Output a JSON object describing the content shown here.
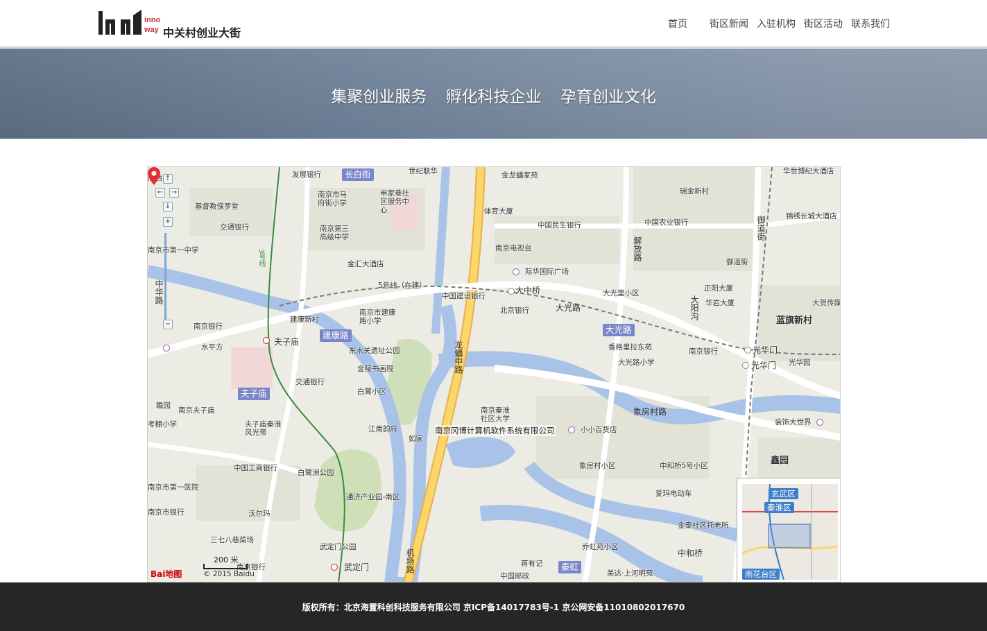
{
  "header": {
    "logo_mark": "in innoway",
    "logo_text": "中关村创业大街",
    "nav": [
      {
        "label": "首页"
      },
      {
        "label": "街区新闻"
      },
      {
        "label": "入驻机构"
      },
      {
        "label": "街区活动"
      },
      {
        "label": "联系我们"
      }
    ]
  },
  "banner": {
    "slogan": [
      "集聚创业服务",
      "孵化科技企业",
      "孕育创业文化"
    ]
  },
  "map": {
    "company_label": "南京冈博计算机软件系统有限公司",
    "scale_label": "200 米",
    "copyright": "© 2015 Baidu",
    "baidu_logo": "Bai地图",
    "zoom_in": "+",
    "zoom_out": "−",
    "district_badges": [
      "长白街",
      "建康路",
      "夫子庙",
      "大光路",
      "秦虹"
    ],
    "minimap_badges": [
      "玄武区",
      "秦淮区",
      "雨花台区"
    ],
    "labels": {
      "l1": "南京市马府街小学",
      "l2": "申家巷社区服务中心",
      "l3": "基督教保罗堂",
      "l4": "交通银行",
      "l5": "南京第三高级中学",
      "l6": "金汇大酒店",
      "l7": "5号线（在建）",
      "l8": "中国建设银行",
      "l9": "南京市建康路小学",
      "l10": "建康新村",
      "l11": "南京银行",
      "l12": "水平方",
      "l13": "夫子庙",
      "l14": "东水关遗址公园",
      "l15": "金陵书画院",
      "l16": "交通银行",
      "l17": "白鹭小区",
      "l18": "南京夫子庙",
      "l19": "夫子庙秦淮风光带",
      "l20": "江南韵府",
      "l21": "中国工商银行",
      "l22": "白鹭洲公园",
      "l23": "南京市第一医院",
      "l24": "通济产业园-南区",
      "l25": "沃尔玛",
      "l26": "三七八巷菜场",
      "l27": "武定门公园",
      "l28": "武定门",
      "l29": "世纪联华",
      "l30": "金龙蟠家苑",
      "l31": "体育大厦",
      "l32": "中国民生银行",
      "l33": "中国农业银行",
      "l34": "南京电视台",
      "l35": "际华国际广场",
      "l36": "大中桥",
      "l37": "北京银行",
      "l38": "大光里小区",
      "l39": "香格里拉东苑",
      "l40": "大光路小学",
      "l41": "南京秦淮社区大学",
      "l42": "如家",
      "l43": "小小百货店",
      "l44": "象房村小区",
      "l45": "中和桥5号小区",
      "l46": "爱玛电动车",
      "l47": "乔虹苑小区",
      "l48": "蒋有记",
      "l49": "中国邮政",
      "l50": "美达·上河明苑",
      "l51": "瑞金新村",
      "l52": "锦绣长城大酒店",
      "l53": "御道街",
      "l54": "正阳大厦",
      "l55": "华岩大厦",
      "l56": "大贺传媒",
      "l57": "蓝旗新村",
      "l58": "南京银行",
      "l59": "光华门",
      "l60": "光华门",
      "l61": "光华园",
      "l62": "装饰大世界",
      "l63": "鑫园",
      "l64": "金泰社区托老所",
      "l65": "中和桥",
      "l66": "华世博纪大酒店",
      "l67": "南京市第一中学",
      "l68": "考棚小学",
      "l69": "瞻园",
      "l70": "南京市银行",
      "l71": "发展银行",
      "l72": "府西",
      "l73": "南京银行"
    },
    "roads": {
      "r1": "龙蟠中路",
      "r2": "解放路",
      "r3": "大光路",
      "r4": "象房村路",
      "r5": "御道街",
      "r6": "大阳沟",
      "r7": "机场路",
      "r8": "中华路",
      "r9": "3号线"
    }
  },
  "footer": {
    "text": "版权所有：北京海置科创科技服务有限公司 京ICP备14017783号-1 京公网安备11010802017670"
  }
}
